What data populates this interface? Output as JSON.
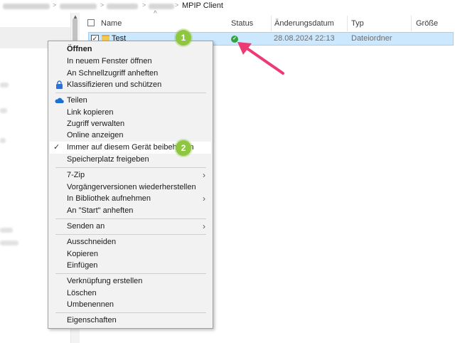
{
  "breadcrumb": {
    "current": "MPIP Client",
    "separator": ">"
  },
  "columns": {
    "name": "Name",
    "status": "Status",
    "date": "Änderungsdatum",
    "type": "Typ",
    "size": "Größe"
  },
  "file_row": {
    "name": "Test",
    "date": "28.08.2024 22:13",
    "type": "Dateiordner",
    "checkmark": "✓",
    "status_glyph": "✓"
  },
  "badges": {
    "one": "1",
    "two": "2"
  },
  "menu": {
    "open": "Öffnen",
    "open_new_window": "In neuem Fenster öffnen",
    "pin_quick_access": "An Schnellzugriff anheften",
    "classify_protect": "Klassifizieren und schützen",
    "share": "Teilen",
    "copy_link": "Link kopieren",
    "manage_access": "Zugriff verwalten",
    "view_online": "Online anzeigen",
    "always_keep": "Immer auf diesem Gerät beibehalten",
    "free_space": "Speicherplatz freigeben",
    "zip": "7-Zip",
    "restore_versions": "Vorgängerversionen wiederherstellen",
    "include_library": "In Bibliothek aufnehmen",
    "pin_start": "An \"Start\" anheften",
    "send_to": "Senden an",
    "cut": "Ausschneiden",
    "copy": "Kopieren",
    "paste": "Einfügen",
    "create_shortcut": "Verknüpfung erstellen",
    "delete": "Löschen",
    "rename": "Umbenennen",
    "properties": "Eigenschaften",
    "checkmark": "✓",
    "submenu_glyph": "›"
  },
  "colors": {
    "selection": "#cce8ff",
    "badge": "#8fc63f",
    "arrow": "#ee3a74",
    "sync_ok": "#2ea53e"
  }
}
